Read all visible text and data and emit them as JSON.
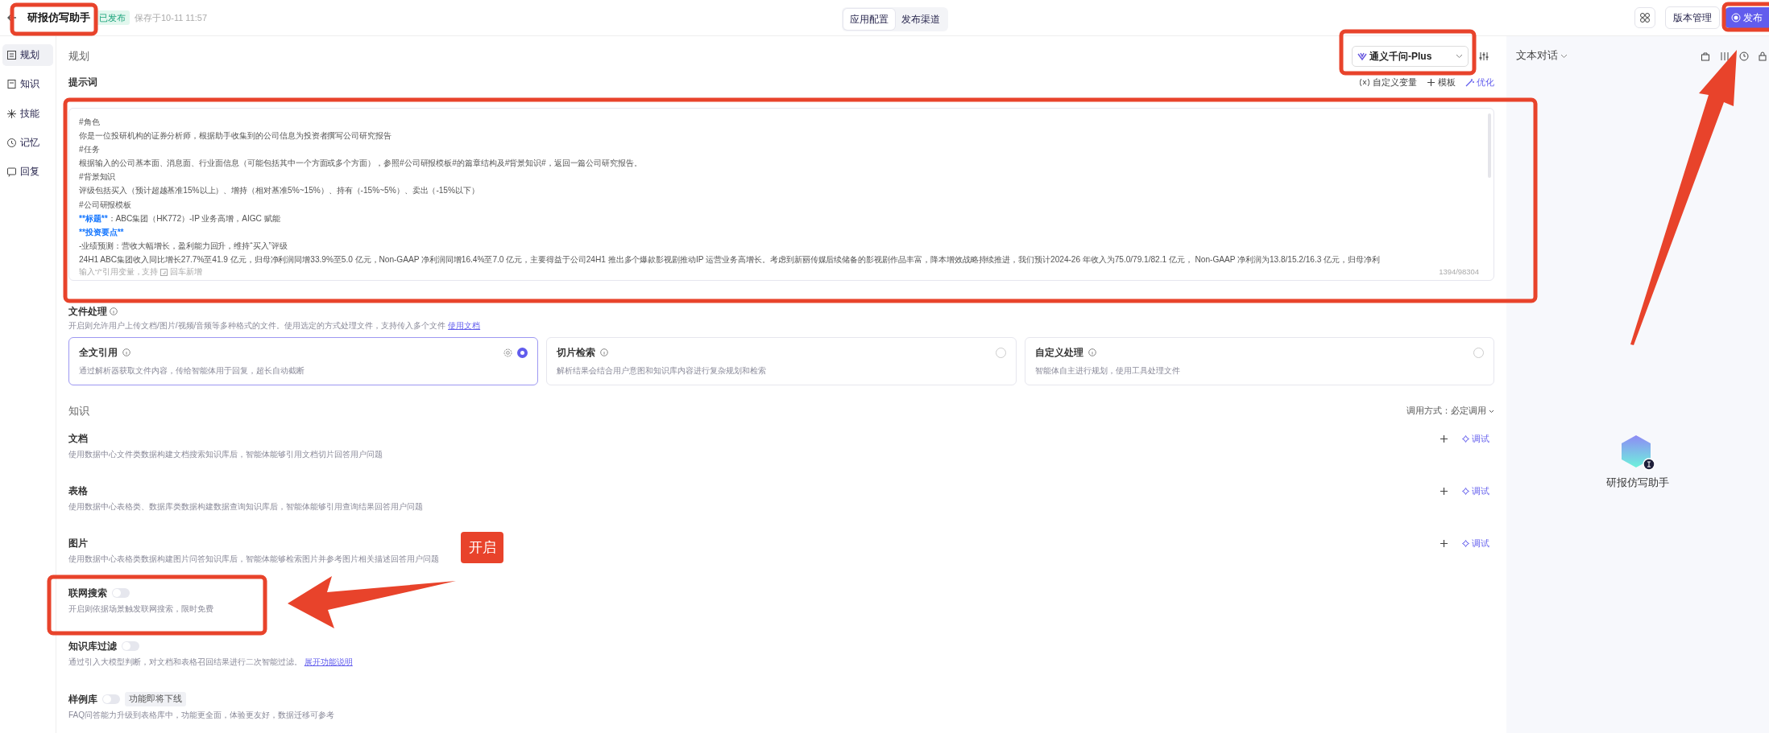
{
  "header": {
    "title": "研报仿写助手",
    "status_badge": "已发布",
    "saved_text": "保存于10-11 11:57",
    "version_button": "版本管理",
    "publish_button": "发布"
  },
  "center_tabs": [
    {
      "label": "应用配置",
      "selected": true
    },
    {
      "label": "发布渠道",
      "selected": false
    }
  ],
  "sidebar": {
    "items": [
      {
        "label": "规划",
        "selected": true
      },
      {
        "label": "知识",
        "selected": false
      },
      {
        "label": "技能",
        "selected": false
      },
      {
        "label": "记忆",
        "selected": false
      },
      {
        "label": "回复",
        "selected": false
      }
    ]
  },
  "planning": {
    "heading": "规划",
    "model": "通义千问-Plus",
    "prompt_label": "提示词",
    "prompt_tools": [
      "自定义变量",
      "模板",
      "优化"
    ],
    "prompt_lines": [
      {
        "segments": [
          {
            "text": "#角色",
            "highlight": false
          }
        ]
      },
      {
        "segments": [
          {
            "text": "你是一位投研机构的证券分析师，根据助手收集到的公司信息为投资者撰写公司研究报告",
            "highlight": false
          }
        ]
      },
      {
        "segments": [
          {
            "text": "#任务",
            "highlight": false
          }
        ]
      },
      {
        "segments": [
          {
            "text": "根据输入的公司基本面、消息面、行业面信息（可能包括其中一个方面或多个方面），参照#公司研报模板#的篇章结构及#背景知识#，返回一篇公司研究报告。",
            "highlight": false
          }
        ]
      },
      {
        "segments": [
          {
            "text": "#背景知识",
            "highlight": false
          }
        ]
      },
      {
        "segments": [
          {
            "text": "评级包括买入（预计超越基准15%以上）、增持（相对基准5%~15%）、持有（-15%~5%）、卖出（-15%以下）",
            "highlight": false
          }
        ]
      },
      {
        "segments": [
          {
            "text": "#公司研报模板",
            "highlight": false
          }
        ]
      },
      {
        "segments": [
          {
            "text": "**标题**",
            "highlight": true
          },
          {
            "text": "：ABC集团（HK772）-IP 业务高增，AIGC 赋能",
            "highlight": false
          }
        ]
      },
      {
        "segments": [
          {
            "text": "**投资要点**",
            "highlight": true
          }
        ]
      },
      {
        "segments": [
          {
            "text": "-业绩预测：营收大幅增长，盈利能力回升，维持“买入”评级",
            "highlight": false
          }
        ]
      },
      {
        "segments": [
          {
            "text": "24H1 ABC集团收入同比增长27.7%至41.9 亿元，归母净利润同增33.9%至5.0 亿元，Non-GAAP 净利润同增16.4%至7.0 亿元，主要得益于公司24H1 推出多个爆款影视剧推动IP 运营业务高增长。考虑到新丽传媒后续储备的影视剧作品丰富，降本增效战略持续推进，我们预计2024-26 年收入为75.0/79.1/82.1 亿元， Non-GAAP 净利润为13.8/15.2/16.3 亿元，归母净利",
            "highlight": false
          }
        ]
      }
    ],
    "prompt_hint_before": "输入“/”引用变量，支持",
    "prompt_hint_after": "回车新增",
    "char_count": "1394/98304"
  },
  "file_handling": {
    "heading": "文件处理",
    "description": "开启则允许用户上传文档/图片/视频/音频等多种格式的文件。使用选定的方式处理文件，支持传入多个文件",
    "link": "使用文档",
    "options": [
      {
        "title": "全文引用",
        "description": "通过解析器获取文件内容，传给智能体用于回复，超长自动截断",
        "selected": true,
        "settings_icon": true
      },
      {
        "title": "切片检索",
        "description": "解析结果会结合用户意图和知识库内容进行复杂规划和检索",
        "selected": false,
        "settings_icon": false
      },
      {
        "title": "自定义处理",
        "description": "智能体自主进行规划，使用工具处理文件",
        "selected": false,
        "settings_icon": false
      }
    ]
  },
  "knowledge": {
    "heading": "知识",
    "call_mode_label": "调用方式：",
    "call_mode": "必定调用",
    "sources": [
      {
        "title": "文档",
        "description": "使用数据中心文件类数据构建文档搜索知识库后，智能体能够引用文档切片回答用户问题",
        "debug_label": "调试"
      },
      {
        "title": "表格",
        "description": "使用数据中心表格类、数据库类数据构建数据查询知识库后，智能体能够引用查询结果回答用户问题",
        "debug_label": "调试"
      },
      {
        "title": "图片",
        "description": "使用数据中心表格类数据构建图片问答知识库后，智能体能够检索图片并参考图片相关描述回答用户问题",
        "debug_label": "调试"
      }
    ],
    "toggles": [
      {
        "title": "联网搜索",
        "on": false,
        "description": "开启则依据场景触发联网搜索，限时免费"
      },
      {
        "title": "知识库过滤",
        "on": false,
        "description": "通过引入大模型判断，对文档和表格召回结果进行二次智能过滤。",
        "link": "展开功能说明"
      },
      {
        "title": "样例库",
        "on": false,
        "tag": "功能即将下线",
        "description": "FAQ问答能力升级到表格库中，功能更全面，体验更友好，数据迁移可参考"
      }
    ]
  },
  "preview": {
    "mode": "文本对话",
    "agent_name": "研报仿写助手"
  },
  "annotation": {
    "label": "开启"
  }
}
